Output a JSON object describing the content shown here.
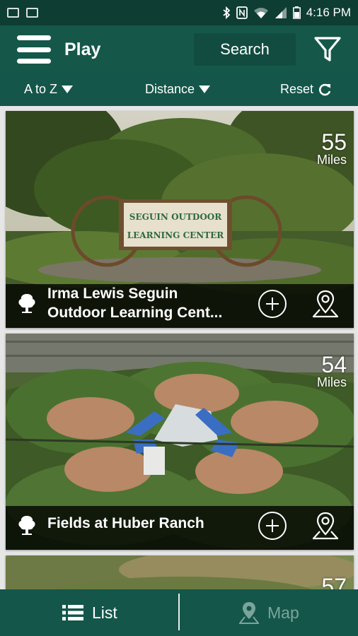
{
  "status_bar": {
    "time": "4:16 PM"
  },
  "app_bar": {
    "title": "Play",
    "search_label": "Search"
  },
  "sort_bar": {
    "alpha_label": "A to Z",
    "distance_label": "Distance",
    "reset_label": "Reset"
  },
  "places": [
    {
      "name_line1": "Irma Lewis Seguin",
      "name_line2": "Outdoor Learning Cent...",
      "distance": "55",
      "unit": "Miles",
      "sign_line1": "SEGUIN OUTDOOR",
      "sign_line2": "LEARNING CENTER"
    },
    {
      "name_line1": "Fields at Huber Ranch",
      "distance": "54",
      "unit": "Miles"
    },
    {
      "distance": "57"
    }
  ],
  "bottom_nav": {
    "list_label": "List",
    "map_label": "Map"
  },
  "colors": {
    "primary": "#15584a",
    "status_bar": "#0e3d33",
    "inactive_tab": "#7aa59b"
  }
}
